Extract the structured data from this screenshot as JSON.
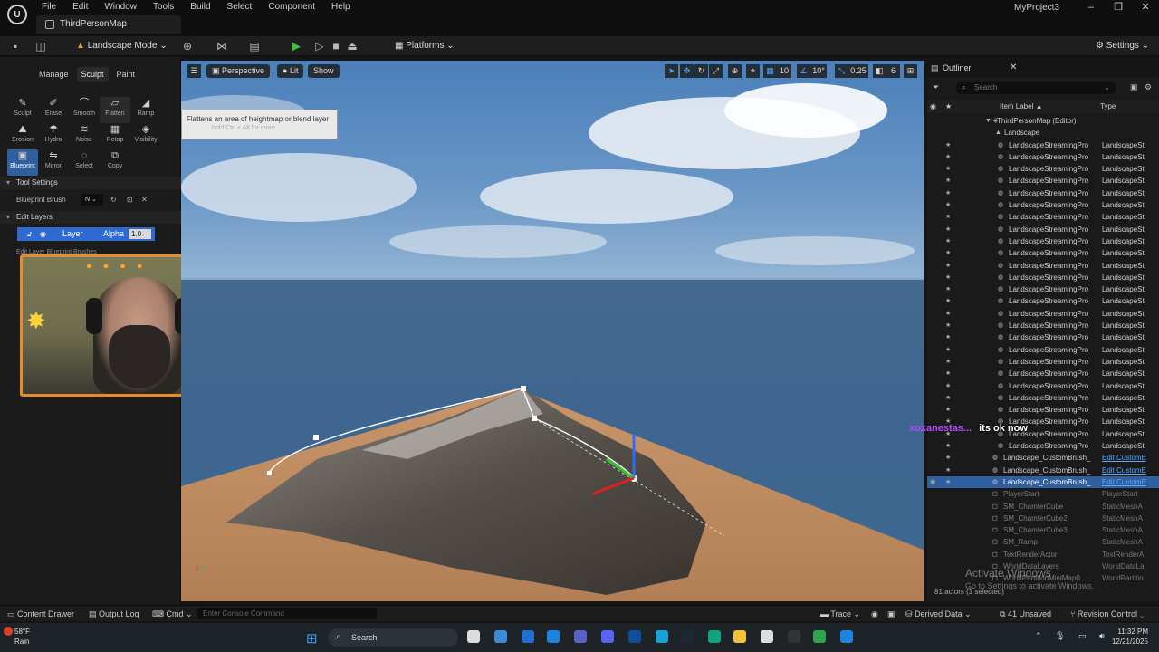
{
  "window": {
    "menu": [
      "File",
      "Edit",
      "Window",
      "Tools",
      "Build",
      "Select",
      "Component",
      "Help"
    ],
    "map_tab": "ThirdPersonMap",
    "project": "MyProject3",
    "controls": [
      "–",
      "❐",
      "✕"
    ]
  },
  "toolbar": {
    "mode": "Landscape Mode",
    "platforms": "Platforms",
    "settings": "Settings"
  },
  "landscape": {
    "tabs": [
      "Manage",
      "Sculpt",
      "Paint"
    ],
    "active_tab": "Sculpt",
    "tools_row1": [
      {
        "label": "Sculpt",
        "icon": "✎"
      },
      {
        "label": "Erase",
        "icon": "✐"
      },
      {
        "label": "Smooth",
        "icon": "⌒"
      },
      {
        "label": "Flatten",
        "icon": "⏥"
      },
      {
        "label": "Ramp",
        "icon": "◢"
      }
    ],
    "tools_row2": [
      {
        "label": "Erosion",
        "icon": "⛰"
      },
      {
        "label": "Hydro",
        "icon": "☂"
      },
      {
        "label": "Noise",
        "icon": "≋"
      },
      {
        "label": "Retop",
        "icon": "▦"
      },
      {
        "label": "Visibility",
        "icon": "◈"
      }
    ],
    "tools_row3": [
      {
        "label": "Blueprint",
        "icon": "▣"
      },
      {
        "label": "Mirror",
        "icon": "⇋"
      },
      {
        "label": "Select",
        "icon": "◌"
      },
      {
        "label": "Copy",
        "icon": "⧉"
      }
    ],
    "tool_settings_header": "Tool Settings",
    "blueprint_brush_label": "Blueprint Brush",
    "blueprint_brush_value": "N",
    "edit_layers_header": "Edit Layers",
    "layer_name": "Layer",
    "layer_alpha_label": "Alpha",
    "layer_alpha_value": "1.0",
    "bp_brushes_header": "Edit Layer Blueprint Brushes"
  },
  "viewport": {
    "perspective": "Perspective",
    "lit": "Lit",
    "show": "Show",
    "grid_snap": "10",
    "rot_snap": "10°",
    "scale_snap": "0.25",
    "cam_speed": "6",
    "tooltip_main": "Flattens an area of heightmap or blend layer",
    "tooltip_sub": "hold Ctrl + Alt for more"
  },
  "outliner": {
    "title": "Outliner",
    "search_placeholder": "Search",
    "col_label": "Item Label ▲",
    "col_type": "Type",
    "root": "ThirdPersonMap (Editor)",
    "landscape": "Landscape",
    "streaming_name": "LandscapeStreamingPro",
    "streaming_type": "LandscapeSt",
    "streaming_count": 26,
    "custom_brushes": [
      {
        "name": "Landscape_CustomBrush_",
        "type": "Edit CustomE"
      },
      {
        "name": "Landscape_CustomBrush_",
        "type": "Edit CustomE"
      },
      {
        "name": "Landscape_CustomBrush_",
        "type": "Edit CustomE"
      }
    ],
    "others": [
      {
        "name": "PlayerStart",
        "type": "PlayerStart"
      },
      {
        "name": "SM_ChamferCube",
        "type": "StaticMeshA"
      },
      {
        "name": "SM_ChamferCube2",
        "type": "StaticMeshA"
      },
      {
        "name": "SM_ChamferCube3",
        "type": "StaticMeshA"
      },
      {
        "name": "SM_Ramp",
        "type": "StaticMeshA"
      },
      {
        "name": "TextRenderActor",
        "type": "TextRenderA"
      },
      {
        "name": "WorldDataLayers",
        "type": "WorldDataLa"
      },
      {
        "name": "WorldPartitionMiniMap0",
        "type": "WorldPartitio"
      }
    ],
    "status": "81 actors (1 selected)"
  },
  "overlay": {
    "chat_user": "xoxanestas...",
    "chat_msg": "its ok now",
    "activate_title": "Activate Windows",
    "activate_sub": "Go to Settings to activate Windows."
  },
  "statusbar": {
    "content_drawer": "Content Drawer",
    "output_log": "Output Log",
    "cmd": "Cmd",
    "console_placeholder": "Enter Console Command",
    "trace": "Trace",
    "derived_data": "Derived Data",
    "unsaved": "41 Unsaved",
    "revision_control": "Revision Control"
  },
  "taskbar": {
    "temp": "58°F",
    "weather": "Rain",
    "search": "Search",
    "time": "11:32 PM",
    "date": "12/21/2025"
  }
}
